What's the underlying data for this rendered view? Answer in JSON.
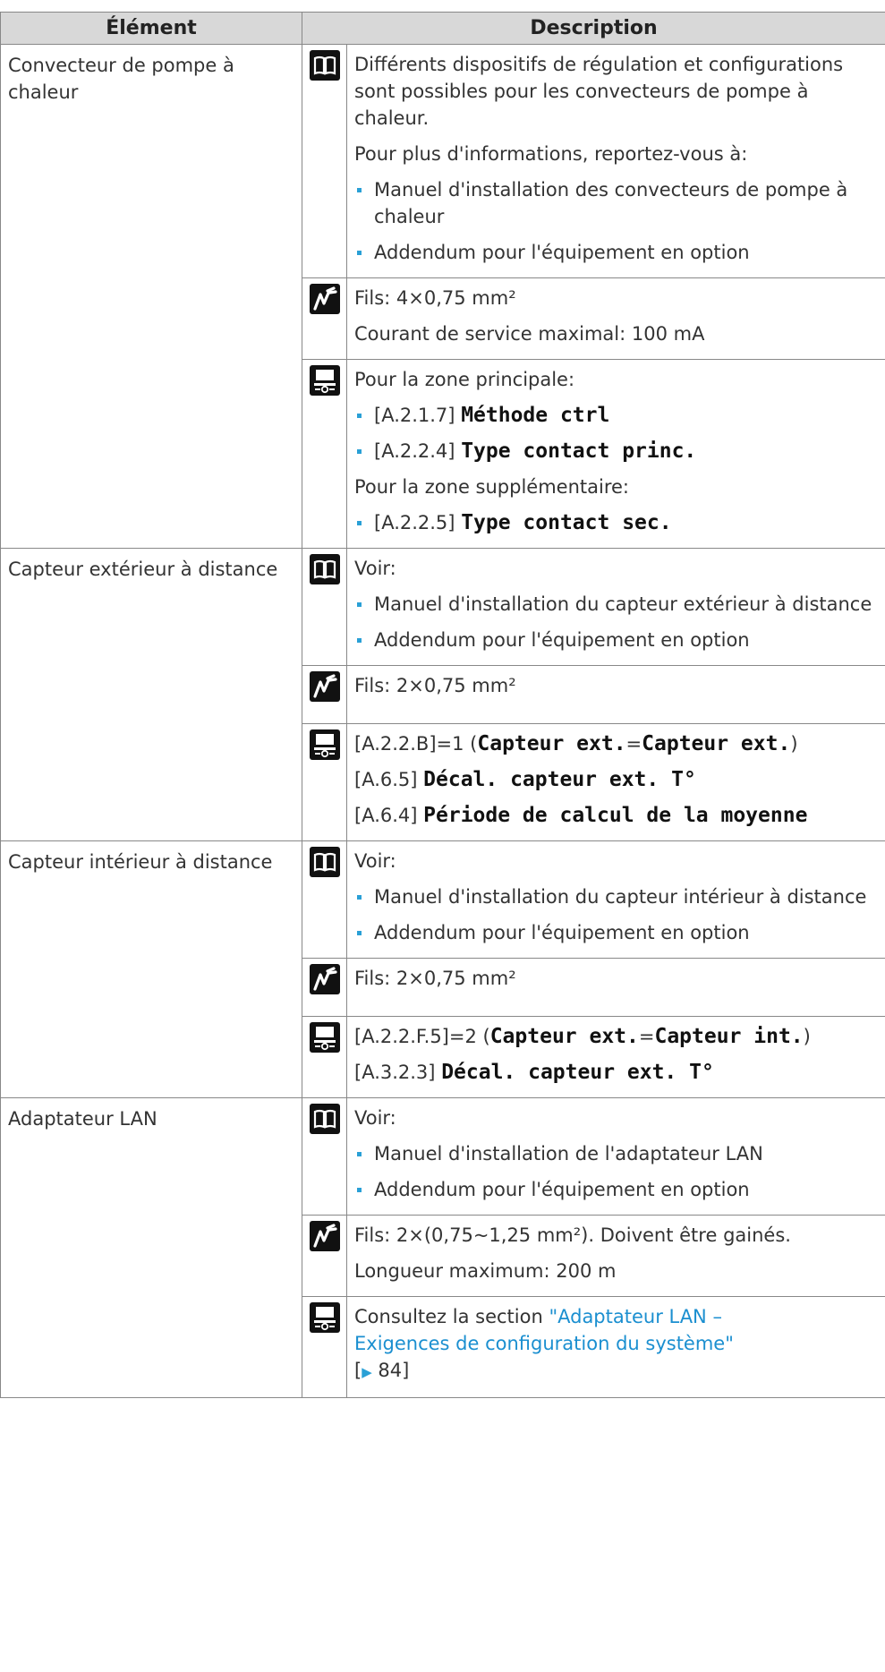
{
  "table": {
    "header": {
      "element": "Élément",
      "description": "Description"
    },
    "rows": [
      {
        "element": "Convecteur de pompe à chaleur",
        "manual": {
          "line1": "Différents dispositifs de régulation et configurations sont possibles pour les convecteurs de pompe à chaleur.",
          "line2": "Pour plus d'informations, reportez-vous à:",
          "bullet1": "Manuel d'installation des convecteurs de pompe à chaleur",
          "bullet2": "Addendum pour l'équipement en option"
        },
        "wiring": {
          "line1": "Fils: 4×0,75 mm²",
          "line2": "Courant de service maximal: 100 mA"
        },
        "settings": {
          "line1": "Pour la zone principale:",
          "b1_code": "[A.2.1.7]",
          "b1_name": "Méthode ctrl",
          "b2_code": "[A.2.2.4]",
          "b2_name": "Type contact princ.",
          "line2": "Pour la zone supplémentaire:",
          "b3_code": "[A.2.2.5]",
          "b3_name": "Type contact sec."
        }
      },
      {
        "element": "Capteur extérieur à distance",
        "manual": {
          "line1": "Voir:",
          "bullet1": "Manuel d'installation du capteur extérieur à distance",
          "bullet2": "Addendum pour l'équipement en option"
        },
        "wiring": {
          "line1": "Fils: 2×0,75 mm²"
        },
        "settings": {
          "l1_code": "[A.2.2.B]=1 (",
          "l1_name": "Capteur ext.",
          "l1_eq": "=",
          "l1_val": "Capteur ext.",
          "l1_end": ")",
          "l2_code": "[A.6.5]",
          "l2_name": "Décal. capteur ext. T°",
          "l3_code": "[A.6.4]",
          "l3_name": "Période de calcul de la moyenne"
        }
      },
      {
        "element": "Capteur intérieur à distance",
        "manual": {
          "line1": "Voir:",
          "bullet1": "Manuel d'installation du capteur intérieur à distance",
          "bullet2": "Addendum pour l'équipement en option"
        },
        "wiring": {
          "line1": "Fils: 2×0,75 mm²"
        },
        "settings": {
          "l1_code": "[A.2.2.F.5]=2 (",
          "l1_name": "Capteur ext.",
          "l1_eq": "=",
          "l1_val": "Capteur int.",
          "l1_end": ")",
          "l2_code": "[A.3.2.3]",
          "l2_name": "Décal. capteur ext. T°"
        }
      },
      {
        "element": "Adaptateur LAN",
        "manual": {
          "line1": "Voir:",
          "bullet1": "Manuel d'installation de l'adaptateur LAN",
          "bullet2": "Addendum pour l'équipement en option"
        },
        "wiring": {
          "line1": "Fils: 2×(0,75~1,25 mm²). Doivent être gainés.",
          "line2": "Longueur maximum: 200 m"
        },
        "settings": {
          "prefix": "Consultez la section ",
          "link": "\"Adaptateur LAN – Exigences de configuration du système\"",
          "ref_open": " [",
          "ref_arrow": "▶",
          "ref_page": " 84",
          "ref_close": "]"
        }
      }
    ]
  },
  "icons": {
    "manual": "open-book-icon",
    "wiring": "wire-icon",
    "settings": "user-interface-controller-icon"
  },
  "colors": {
    "bullet": "#2aa0d6",
    "link": "#1b8fd0",
    "header_bg": "#d8d8d8",
    "border": "#888888"
  }
}
